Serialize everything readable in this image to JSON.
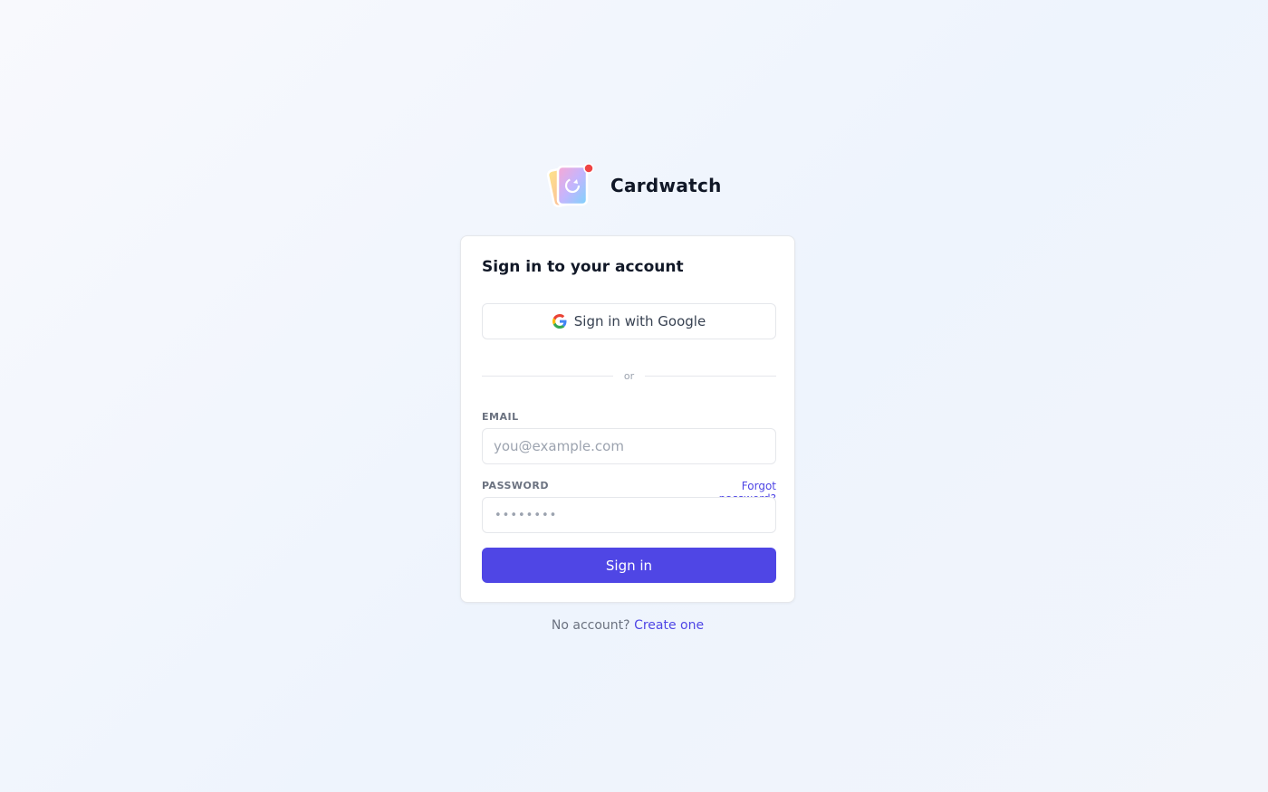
{
  "brand": {
    "name": "Cardwatch",
    "logo_icon": "card-refresh-logo-icon",
    "notification_dot_color": "#ef4444"
  },
  "card": {
    "title": "Sign in to your account",
    "google_button_label": "Sign in with Google",
    "google_icon": "google-g-icon",
    "divider_text": "or",
    "email": {
      "label": "EMAIL",
      "placeholder": "you@example.com",
      "value": ""
    },
    "password": {
      "label": "PASSWORD",
      "masked_value": "••••••••",
      "forgot_link": "Forgot password?"
    },
    "submit_label": "Sign in"
  },
  "footer": {
    "prompt": "No account? ",
    "link": "Create one"
  },
  "colors": {
    "accent": "#4f46e5",
    "text": "#111827",
    "muted": "#6b7280",
    "border": "#e5e7eb"
  }
}
